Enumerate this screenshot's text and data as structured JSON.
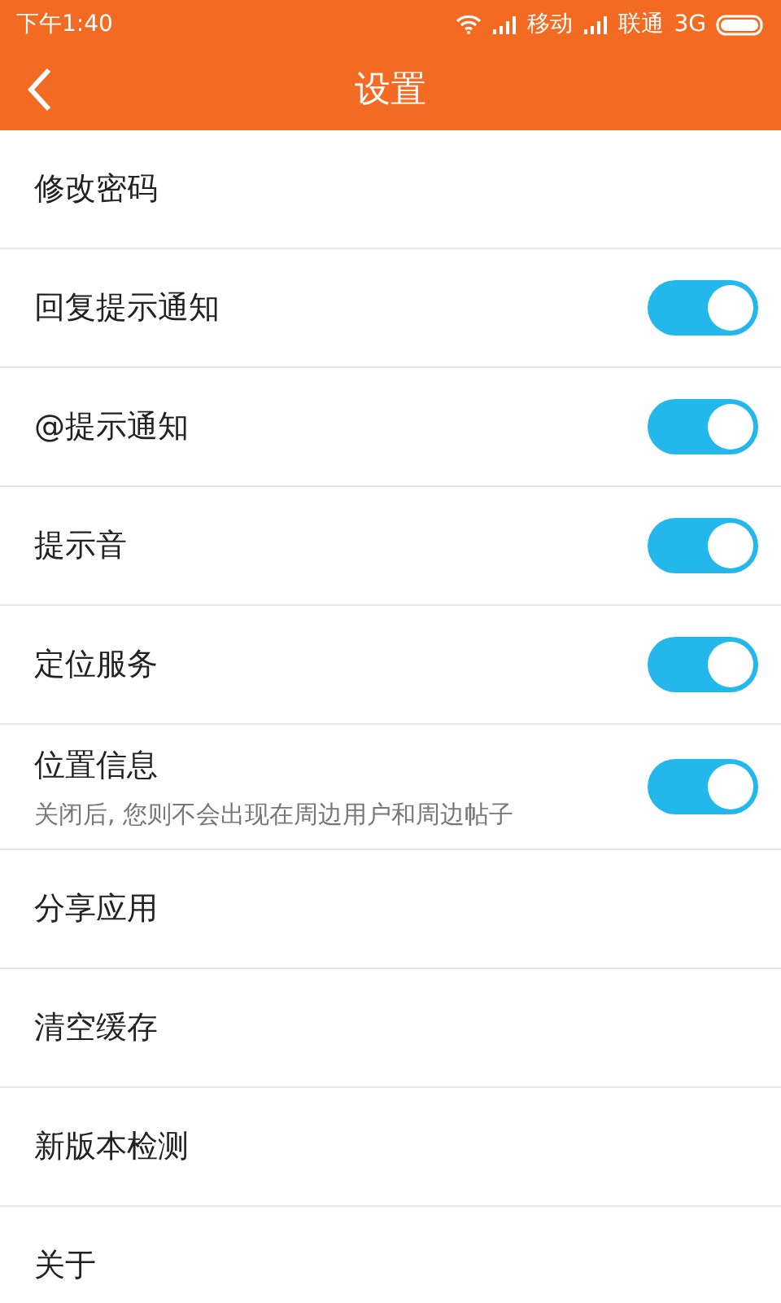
{
  "status_bar": {
    "time": "下午1:40",
    "carrier_1": "移动",
    "carrier_2": "联通",
    "network": "3G"
  },
  "header": {
    "title": "设置"
  },
  "items": [
    {
      "kind": "link",
      "label": "修改密码"
    },
    {
      "kind": "toggle",
      "label": "回复提示通知",
      "on": true
    },
    {
      "kind": "toggle",
      "label": "@提示通知",
      "on": true
    },
    {
      "kind": "toggle",
      "label": "提示音",
      "on": true
    },
    {
      "kind": "toggle",
      "label": "定位服务",
      "on": true
    },
    {
      "kind": "toggle",
      "label": "位置信息",
      "on": true,
      "subtitle": "关闭后, 您则不会出现在周边用户和周边帖子"
    },
    {
      "kind": "link",
      "label": "分享应用"
    },
    {
      "kind": "link",
      "label": "清空缓存"
    },
    {
      "kind": "link",
      "label": "新版本检测"
    },
    {
      "kind": "link",
      "label": "关于"
    }
  ]
}
